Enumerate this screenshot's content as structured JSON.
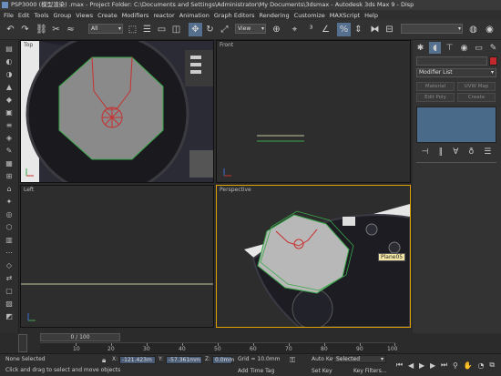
{
  "title": "PSP3000 (模型渲染) .max  -  Project Folder: C:\\Documents and Settings\\Administrator\\My Documents\\3dsmax   -  Autodesk 3ds Max 9      -  Disp",
  "menu": [
    "File",
    "Edit",
    "Tools",
    "Group",
    "Views",
    "Create",
    "Modifiers",
    "reactor",
    "Animation",
    "Graph Editors",
    "Rendering",
    "Customize",
    "MAXScript",
    "Help"
  ],
  "toolbar": {
    "selection_filter": "All",
    "ref_coord": "View"
  },
  "viewports": {
    "top": "Top",
    "front": "Front",
    "left": "Left",
    "perspective": "Perspective"
  },
  "object_tooltip": "Plane05",
  "command_panel": {
    "modifier_list": "Modifier List",
    "buttons": [
      "Material",
      "UVW Map",
      "Edit Poly",
      "Create"
    ]
  },
  "timeline": {
    "frame_slider": "0 / 100",
    "ticks": [
      "10",
      "20",
      "30",
      "40",
      "50",
      "60",
      "70",
      "80",
      "90",
      "100"
    ]
  },
  "status": {
    "selection": "None Selected",
    "prompt": "Click and drag to select and move objects",
    "x_label": "X:",
    "x_value": "-121.423m",
    "y_label": "Y:",
    "y_value": "-57.361mm",
    "z_label": "Z:",
    "z_value": "0.0mm",
    "grid": "Grid = 10.0mm",
    "add_time_tag": "Add Time Tag",
    "auto_key": "Auto Key",
    "auto_key_target": "Selected",
    "set_key": "Set Key",
    "key_filters": "Key Filters..."
  },
  "colors": {
    "accent": "#55708f",
    "active_viewport": "#e0a000",
    "object": "#8a8a8a",
    "selection_edge": "#3aa84a",
    "pivot": "#c83030"
  }
}
